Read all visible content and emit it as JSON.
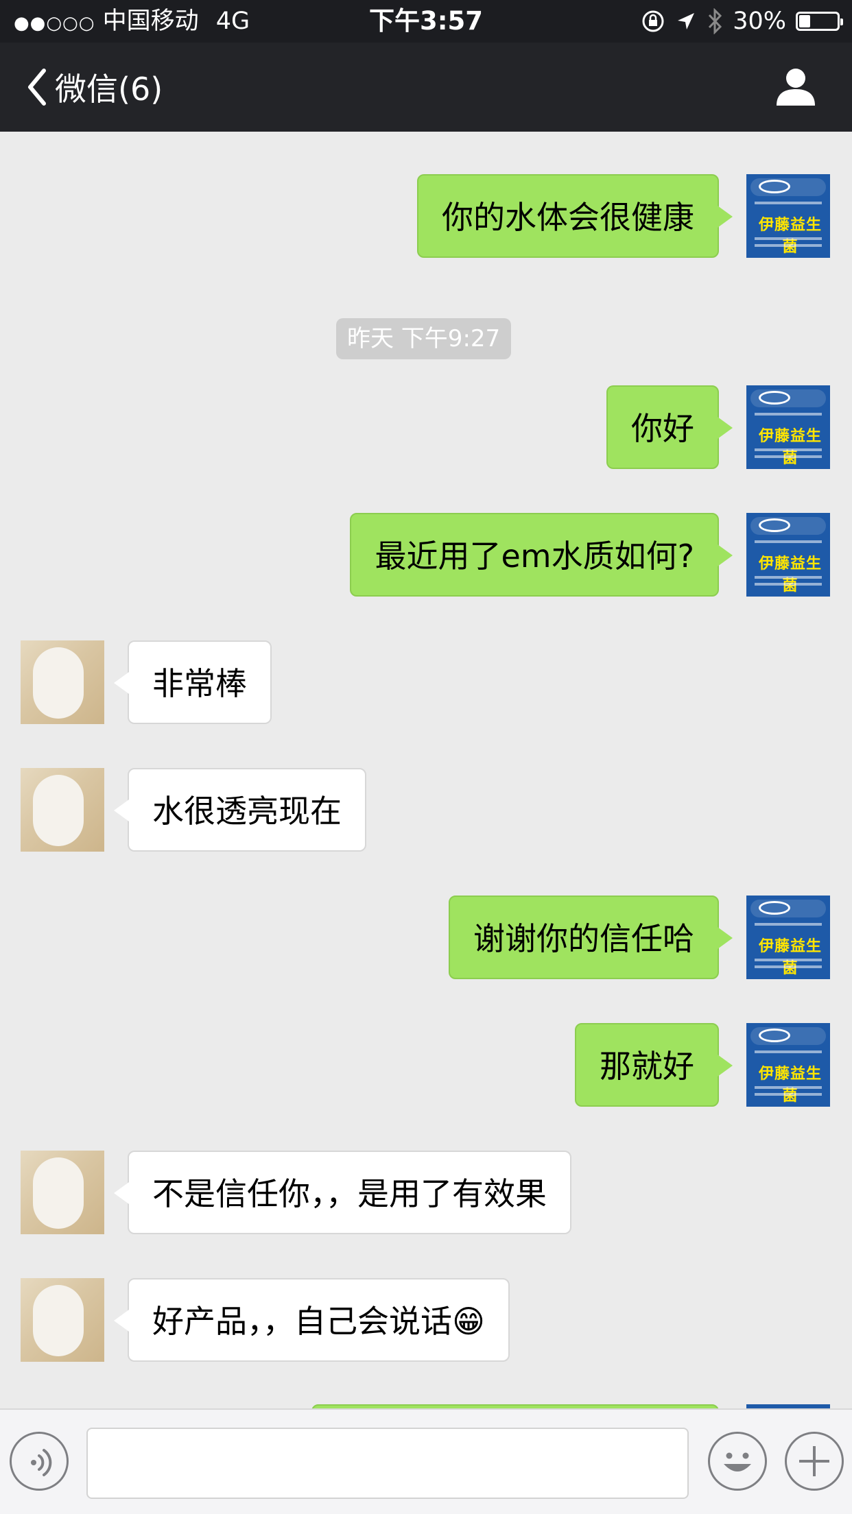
{
  "status_bar": {
    "signal": "●●○○○",
    "carrier": "中国移动",
    "network": "4G",
    "time": "下午3:57",
    "battery_text": "30%",
    "battery_level": 0.3
  },
  "nav": {
    "back_label": "微信(6)",
    "back_icon": "chevron-left-icon",
    "profile_icon": "person-icon"
  },
  "avatar_me": {
    "brand_text": "伊藤益生菌"
  },
  "timestamp": "昨天 下午9:27",
  "messages": [
    {
      "from": "me",
      "text": "你的水体会很健康"
    },
    {
      "from": "me",
      "text": "你好"
    },
    {
      "from": "me",
      "text": "最近用了em水质如何?"
    },
    {
      "from": "other",
      "text": "非常棒"
    },
    {
      "from": "other",
      "text": "水很透亮现在"
    },
    {
      "from": "me",
      "text": "谢谢你的信任哈"
    },
    {
      "from": "me",
      "text": "那就好"
    },
    {
      "from": "other",
      "text": "不是信任你，，是用了有效果"
    },
    {
      "from": "other",
      "text": "好产品，，自己会说话😁"
    }
  ],
  "colors": {
    "my_bubble": "#9fe35f",
    "other_bubble": "#ffffff",
    "nav_bg": "#232428",
    "chat_bg": "#ebebeb"
  },
  "toolbar": {
    "voice_icon": "voice-icon",
    "emoji_icon": "emoji-icon",
    "plus_icon": "plus-icon",
    "input_value": ""
  }
}
